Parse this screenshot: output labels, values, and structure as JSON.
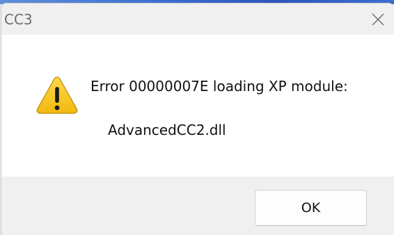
{
  "window": {
    "title": "CC3",
    "close_icon": "close-icon"
  },
  "message": {
    "icon": "warning-icon",
    "line1": "Error 00000007E loading XP module:",
    "line2": "AdvancedCC2.dll"
  },
  "buttons": {
    "ok_label": "OK"
  },
  "colors": {
    "warning_fill": "#f7c824",
    "warning_border": "#c8961c",
    "content_bg": "#ffffff",
    "chrome_bg": "#f0f0f0"
  }
}
